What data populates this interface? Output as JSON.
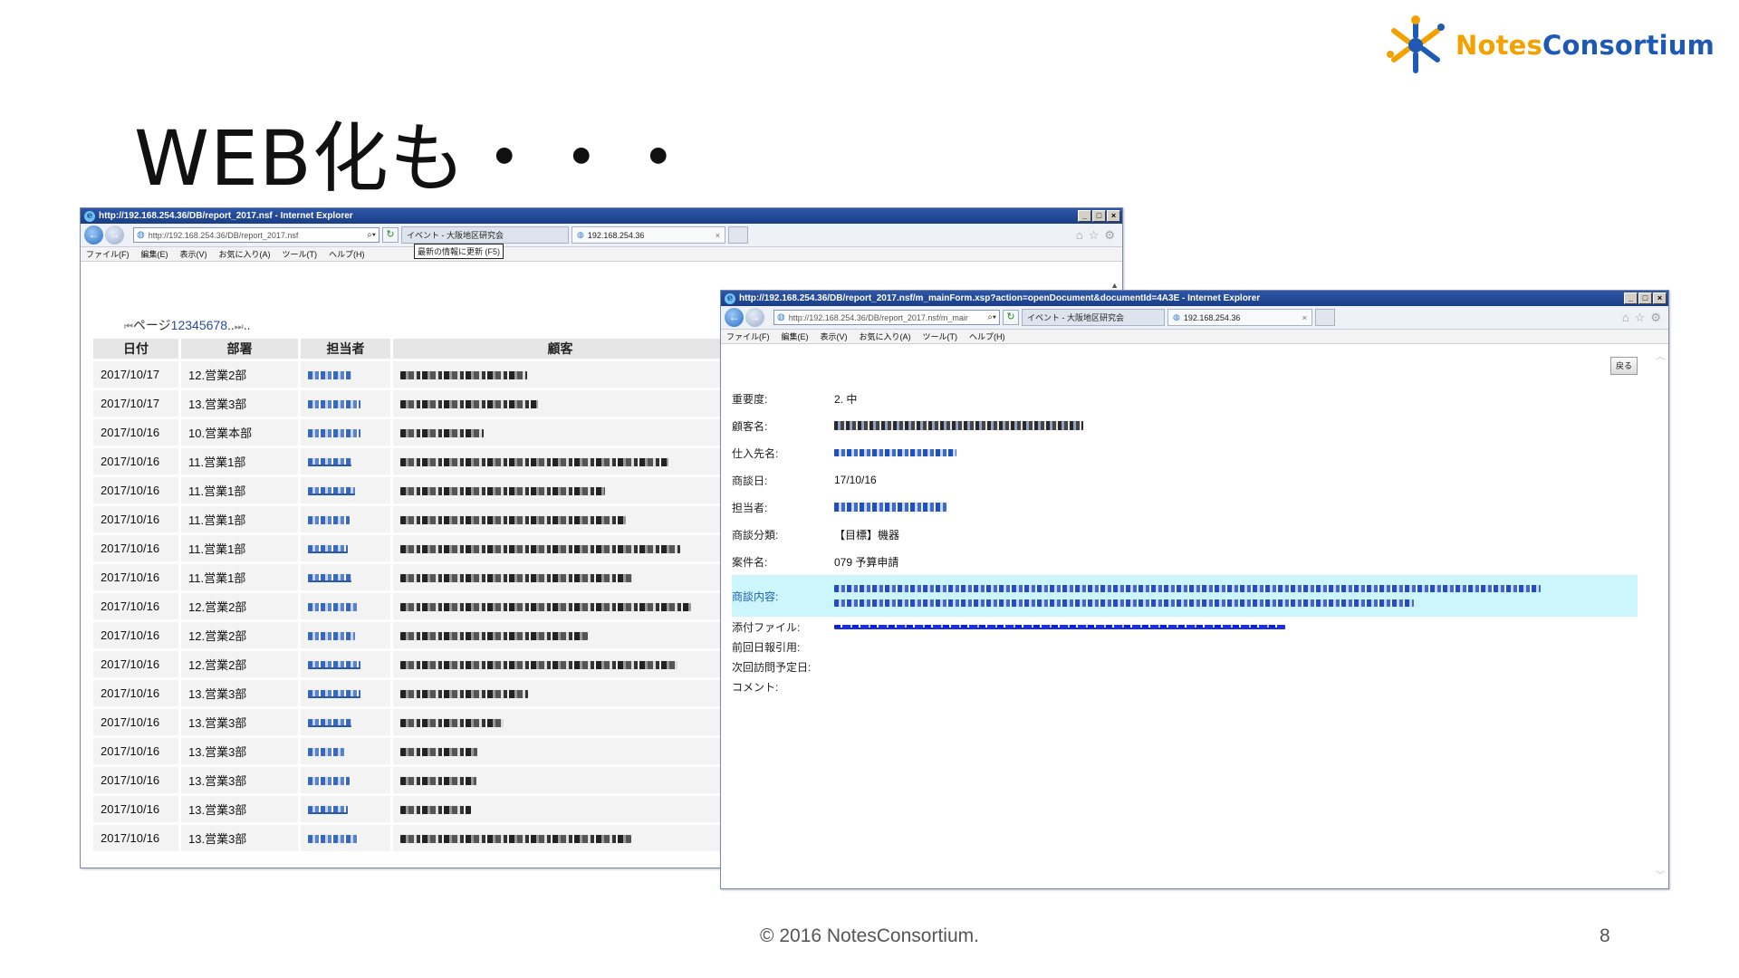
{
  "slide": {
    "logo_notes": "Notes",
    "logo_consortium": "Consortium",
    "title": "WEB化も・・・",
    "footer": "© 2016 NotesConsortium.",
    "page_number": "8"
  },
  "window_list": {
    "title": "http://192.168.254.36/DB/report_2017.nsf - Internet Explorer",
    "address": "http://192.168.254.36/DB/report_2017.nsf",
    "tabs": [
      {
        "label": "イベント - 大阪地区研究会"
      },
      {
        "label": "192.168.254.36"
      }
    ],
    "tooltip": "最新の情報に更新 (F5)",
    "menu": [
      "ファイル(F)",
      "編集(E)",
      "表示(V)",
      "お気に入り(A)",
      "ツール(T)",
      "ヘルプ(H)"
    ],
    "pager": {
      "prefix": "ページ",
      "pages": [
        "1",
        "2",
        "3",
        "4",
        "5",
        "6",
        "7",
        "8"
      ],
      "suffix": ".."
    },
    "columns": [
      "日付",
      "部署",
      "担当者",
      "顧客"
    ],
    "rows": [
      {
        "date": "2017/10/17",
        "dept": "12.営業2部"
      },
      {
        "date": "2017/10/17",
        "dept": "13.営業3部"
      },
      {
        "date": "2017/10/16",
        "dept": "10.営業本部"
      },
      {
        "date": "2017/10/16",
        "dept": "11.営業1部"
      },
      {
        "date": "2017/10/16",
        "dept": "11.営業1部"
      },
      {
        "date": "2017/10/16",
        "dept": "11.営業1部"
      },
      {
        "date": "2017/10/16",
        "dept": "11.営業1部"
      },
      {
        "date": "2017/10/16",
        "dept": "11.営業1部"
      },
      {
        "date": "2017/10/16",
        "dept": "12.営業2部"
      },
      {
        "date": "2017/10/16",
        "dept": "12.営業2部"
      },
      {
        "date": "2017/10/16",
        "dept": "12.営業2部"
      },
      {
        "date": "2017/10/16",
        "dept": "13.営業3部"
      },
      {
        "date": "2017/10/16",
        "dept": "13.営業3部"
      },
      {
        "date": "2017/10/16",
        "dept": "13.営業3部"
      },
      {
        "date": "2017/10/16",
        "dept": "13.営業3部"
      },
      {
        "date": "2017/10/16",
        "dept": "13.営業3部"
      },
      {
        "date": "2017/10/16",
        "dept": "13.営業3部"
      }
    ]
  },
  "window_doc": {
    "title": "http://192.168.254.36/DB/report_2017.nsf/m_mainForm.xsp?action=openDocument&documentId=4A3E - Internet Explorer",
    "address": "http://192.168.254.36/DB/report_2017.nsf/m_mair",
    "tabs": [
      {
        "label": "イベント - 大阪地区研究会"
      },
      {
        "label": "192.168.254.36"
      }
    ],
    "menu": [
      "ファイル(F)",
      "編集(E)",
      "表示(V)",
      "お気に入り(A)",
      "ツール(T)",
      "ヘルプ(H)"
    ],
    "back_label": "戻る",
    "fields": {
      "priority_label": "重要度:",
      "priority_value": "2. 中",
      "customer_label": "顧客名:",
      "supplier_label": "仕入先名:",
      "meeting_date_label": "商談日:",
      "meeting_date_value": "17/10/16",
      "rep_label": "担当者:",
      "category_label": "商談分類:",
      "category_value": "【目標】機器",
      "project_label": "案件名:",
      "project_value": "079 予算申請",
      "content_label": "商談内容:",
      "attachment_label": "添付ファイル:",
      "prev_report_label": "前回日報引用:",
      "next_visit_label": "次回訪問予定日:",
      "comment_label": "コメント:"
    }
  }
}
